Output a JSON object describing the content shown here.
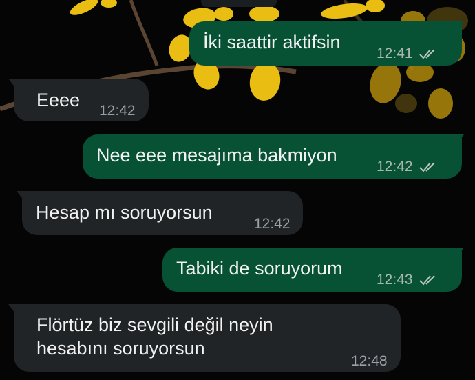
{
  "conversation": {
    "messages": [
      {
        "direction": "outgoing",
        "text": "İki saattir aktifsin",
        "time": "12:41",
        "status": "read-double-check"
      },
      {
        "direction": "incoming",
        "text": "Eeee",
        "time": "12:42"
      },
      {
        "direction": "outgoing",
        "text": "Nee eee mesajıma bakmiyon",
        "time": "12:42",
        "status": "read-double-check"
      },
      {
        "direction": "incoming",
        "text": "Hesap mı soruyorsun",
        "time": "12:42"
      },
      {
        "direction": "outgoing",
        "text": "Tabiki de soruyorum",
        "time": "12:43",
        "status": "read-double-check"
      },
      {
        "direction": "incoming",
        "text": "Flörtüz biz sevgili değil neyin\nhesabını  soruyorsun",
        "time": "12:48"
      }
    ]
  },
  "theme": {
    "outgoing_bubble": "#075235",
    "incoming_bubble": "#202427",
    "background": "#050505",
    "wallpaper_flower": "#f1c40f"
  }
}
